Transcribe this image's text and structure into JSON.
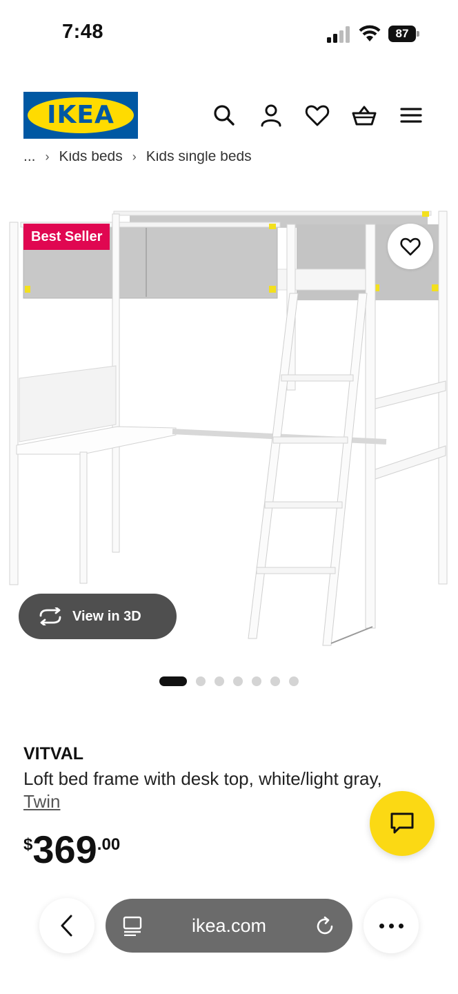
{
  "status_bar": {
    "time": "7:48",
    "battery": "87"
  },
  "header": {
    "logo_text": "IKEA",
    "icons": [
      "search-icon",
      "account-icon",
      "heart-icon",
      "basket-icon",
      "menu-icon"
    ]
  },
  "breadcrumb": {
    "items": [
      "...",
      "Kids beds",
      "Kids single beds"
    ]
  },
  "product_image": {
    "badge": "Best Seller",
    "view_3d_label": "View in 3D",
    "image_count": 7,
    "active_image": 1
  },
  "product": {
    "name": "VITVAL",
    "description": "Loft bed frame with desk top, white/light gray,",
    "variant": "Twin",
    "price": {
      "currency": "$",
      "main": "369",
      "cents": ".00"
    }
  },
  "browser": {
    "url": "ikea.com"
  },
  "colors": {
    "ikea_blue": "#0058a3",
    "ikea_yellow": "#ffdb00",
    "badge_red": "#e00751",
    "chat_yellow": "#fbd914"
  }
}
